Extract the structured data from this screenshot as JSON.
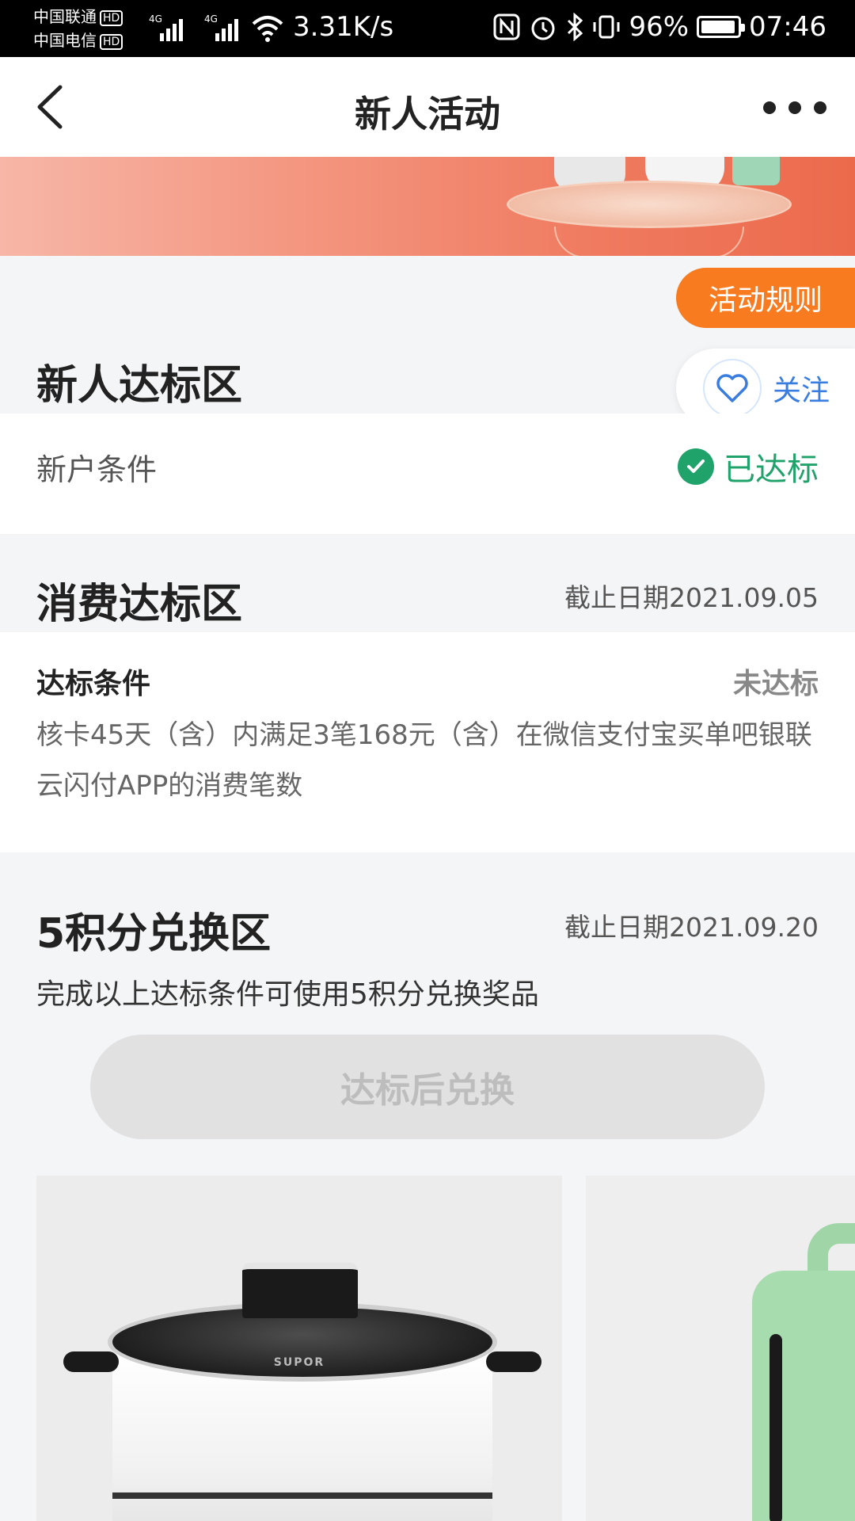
{
  "status_bar": {
    "carrier1": "中国联通",
    "carrier2": "中国电信",
    "hd_badge": "HD",
    "net_type": "4G",
    "net_speed": "3.31K/s",
    "battery_percent": "96%",
    "battery_level": 0.96,
    "time": "07:46"
  },
  "nav": {
    "title": "新人活动"
  },
  "floating": {
    "rules_label": "活动规则",
    "follow_label": "关注"
  },
  "sections": {
    "newcomer": {
      "title": "新人达标区",
      "condition_label": "新户条件",
      "status": "已达标"
    },
    "consumption": {
      "title": "消费达标区",
      "deadline": "截止日期2021.09.05",
      "condition_head": "达标条件",
      "status": "未达标",
      "description": "核卡45天（含）内满足3笔168元（含）在微信支付宝买单吧银联云闪付APP的消费笔数"
    },
    "exchange": {
      "title": "5积分兑换区",
      "deadline": "截止日期2021.09.20",
      "description": "完成以上达标条件可使用5积分兑换奖品",
      "button_label": "达标后兑换",
      "product1_brand": "SUPOR"
    }
  },
  "colors": {
    "accent_orange": "#f97b20",
    "success_green": "#1fa36b",
    "link_blue": "#3a7de0",
    "disabled_gray": "#e1e1e1"
  }
}
